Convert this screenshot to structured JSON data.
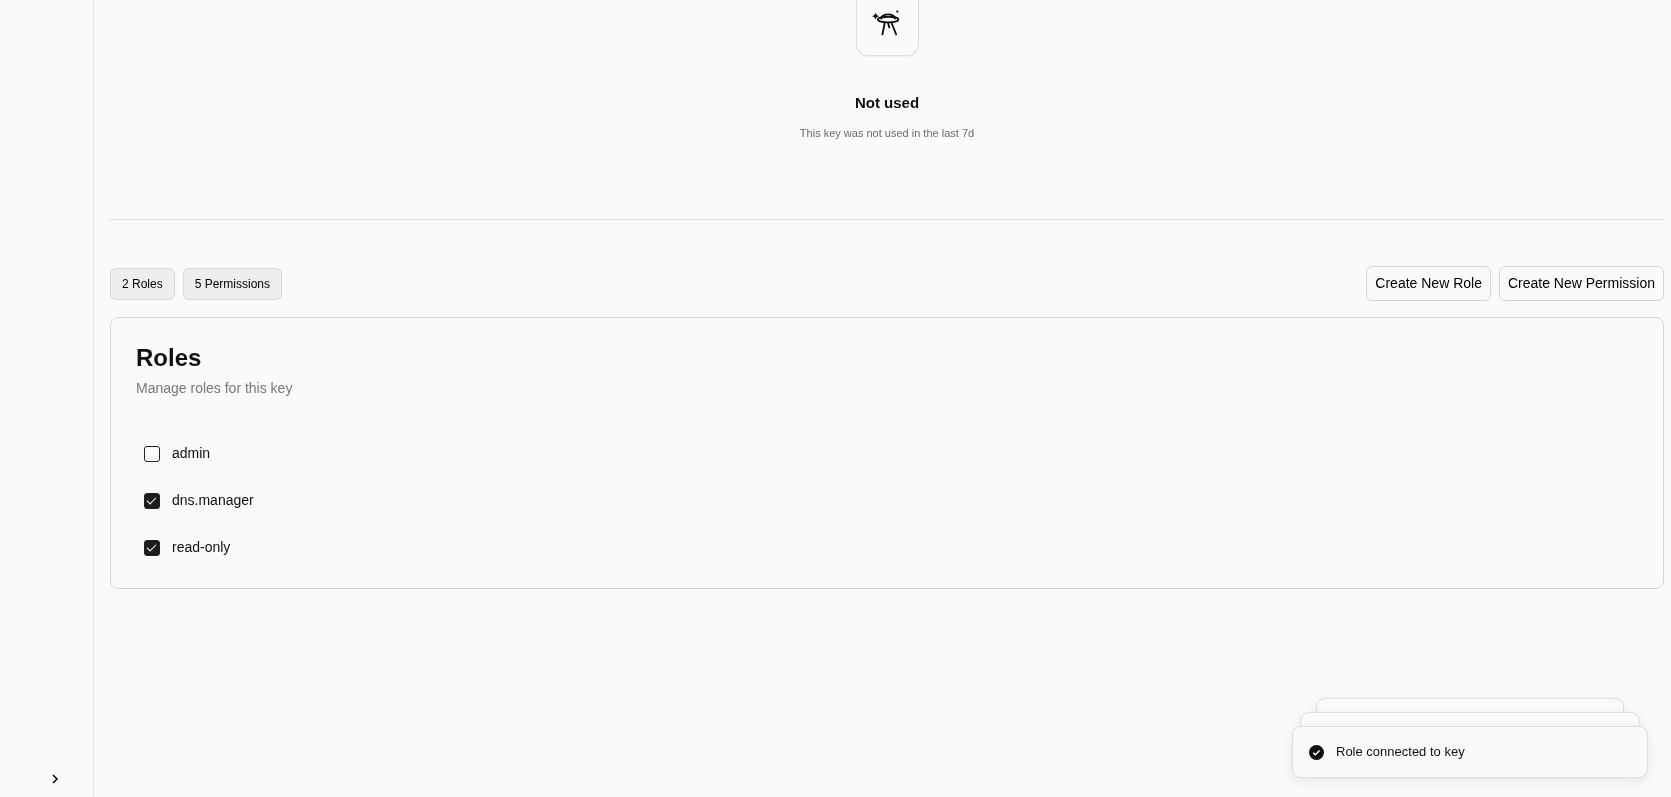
{
  "empty_state": {
    "title": "Not used",
    "description": "This key was not used in the last 7d"
  },
  "counts": [
    "2 Roles",
    "5 Permissions"
  ],
  "actions": [
    "Create New Role",
    "Create New Permission"
  ],
  "roles_card": {
    "title": "Roles",
    "description": "Manage roles for this key",
    "roles": [
      {
        "name": "admin",
        "checked": false
      },
      {
        "name": "dns.manager",
        "checked": true
      },
      {
        "name": "read-only",
        "checked": true
      }
    ]
  },
  "toast": {
    "message": "Role connected to key"
  }
}
